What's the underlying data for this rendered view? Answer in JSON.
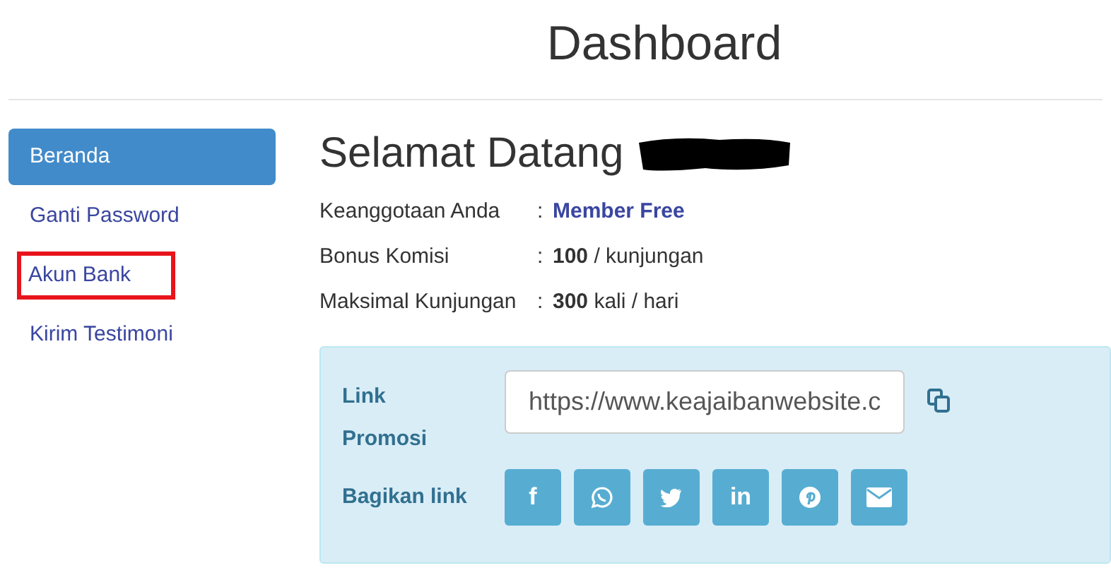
{
  "page_title": "Dashboard",
  "sidebar": {
    "items": [
      {
        "label": "Beranda",
        "selected": true,
        "highlighted": false
      },
      {
        "label": "Ganti Password",
        "selected": false,
        "highlighted": false
      },
      {
        "label": "Akun Bank",
        "selected": false,
        "highlighted": true
      },
      {
        "label": "Kirim Testimoni",
        "selected": false,
        "highlighted": false
      }
    ]
  },
  "greeting": {
    "text": "Selamat Datang",
    "name_redacted": true
  },
  "info_rows": [
    {
      "label": "Keanggotaan Anda",
      "separator": ":",
      "value": "Member Free",
      "kind": "link"
    },
    {
      "label": "Bonus Komisi",
      "separator": ":",
      "value": "**100** / kunjungan",
      "kind": "plain"
    },
    {
      "label": "Maksimal Kunjungan",
      "separator": ":",
      "value": "**300** kali / hari",
      "kind": "plain"
    }
  ],
  "promo_panel": {
    "link_label": "Link Promosi",
    "link_value": "https://www.keajaibanwebsite.c",
    "share_label": "Bagikan link",
    "share_buttons": [
      {
        "kind": "glyph",
        "glyph": "f"
      },
      {
        "kind": "chat"
      },
      {
        "kind": "bird"
      },
      {
        "kind": "glyph",
        "glyph": "in"
      },
      {
        "kind": "pin"
      },
      {
        "kind": "envelope"
      }
    ]
  }
}
